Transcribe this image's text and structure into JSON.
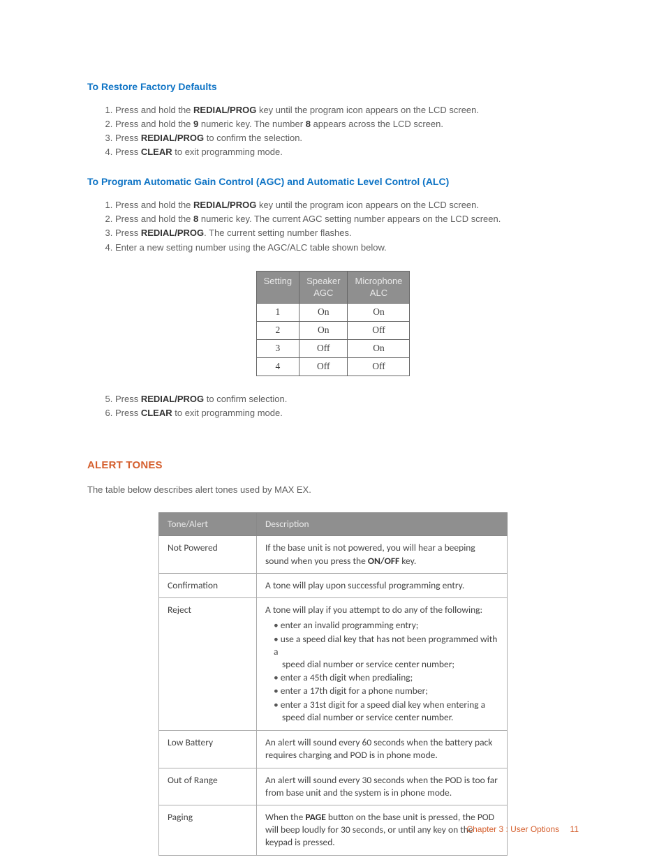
{
  "sec1": {
    "heading": "To Restore Factory Defaults",
    "steps": [
      {
        "pre": "Press and hold the ",
        "b": "REDIAL/PROG",
        "post": " key until the program icon appears on the LCD screen."
      },
      {
        "pre": "Press and hold the ",
        "b": "9",
        "mid": " numeric key. The number ",
        "b2": "8",
        "post": " appears across the LCD screen."
      },
      {
        "pre": "Press ",
        "b": "REDIAL/PROG",
        "post": " to confirm the selection."
      },
      {
        "pre": "Press ",
        "b": "CLEAR",
        "post": " to exit programming mode."
      }
    ]
  },
  "sec2": {
    "heading": "To Program Automatic Gain Control (AGC) and Automatic Level Control (ALC)",
    "steps_a": [
      {
        "pre": "Press and hold the ",
        "b": "REDIAL/PROG",
        "post": " key until the program icon appears on the LCD screen."
      },
      {
        "pre": "Press and hold the ",
        "b": "8",
        "post": " numeric key. The current AGC setting number appears on the LCD screen."
      },
      {
        "pre": "Press ",
        "b": "REDIAL/PROG",
        "post": ". The current setting number flashes."
      },
      {
        "txt": "Enter a new setting number using the AGC/ALC table shown below."
      }
    ],
    "steps_b": [
      {
        "pre": "Press ",
        "b": "REDIAL/PROG",
        "post": " to confirm selection."
      },
      {
        "pre": "Press ",
        "b": "CLEAR",
        "post": " to exit programming mode."
      }
    ]
  },
  "agc_table": {
    "headers": {
      "c1": "Setting",
      "c2a": "Speaker",
      "c2b": "AGC",
      "c3a": "Microphone",
      "c3b": "ALC"
    },
    "rows": [
      {
        "s": "1",
        "a": "On",
        "m": "On"
      },
      {
        "s": "2",
        "a": "On",
        "m": "Off"
      },
      {
        "s": "3",
        "a": "Off",
        "m": "On"
      },
      {
        "s": "4",
        "a": "Off",
        "m": "Off"
      }
    ]
  },
  "alerts": {
    "heading": "ALERT TONES",
    "intro": "The table below describes alert tones used by MAX EX.",
    "headers": {
      "c1": "Tone/Alert",
      "c2": "Description"
    },
    "rows": {
      "not_powered": {
        "label": "Not Powered",
        "pre": "If the base unit is not powered, you will hear a beeping sound when you press the ",
        "b": "ON/OFF",
        "post": " key."
      },
      "confirmation": {
        "label": "Confirmation",
        "txt": "A tone will play upon successful programming entry."
      },
      "reject": {
        "label": "Reject",
        "intro": "A tone will play if you attempt to do any of the following:",
        "b1": "enter an invalid programming entry;",
        "b2a": "use a speed dial key that has not been programmed with a",
        "b2b": "speed dial number or service center number;",
        "b3": "enter a 45th digit when predialing;",
        "b4": "enter a 17th digit for a phone number;",
        "b5a": "enter a 31st digit for a speed dial key when entering a",
        "b5b": "speed dial number or service center number."
      },
      "low_battery": {
        "label": "Low Battery",
        "txt": "An alert will sound every 60 seconds when the battery pack requires charging and POD is in phone mode."
      },
      "out_of_range": {
        "label": "Out of Range",
        "txt": "An alert will sound every 30 seconds when the POD is too far from base unit and the system is in phone mode."
      },
      "paging": {
        "label": "Paging",
        "pre": "When the ",
        "b": "PAGE",
        "post": " button on the base unit is pressed, the POD will beep loudly for 30 seconds, or until any key on the keypad is pressed."
      }
    }
  },
  "footer": {
    "chapter": "Chapter 3 : User Options",
    "page": "11"
  }
}
